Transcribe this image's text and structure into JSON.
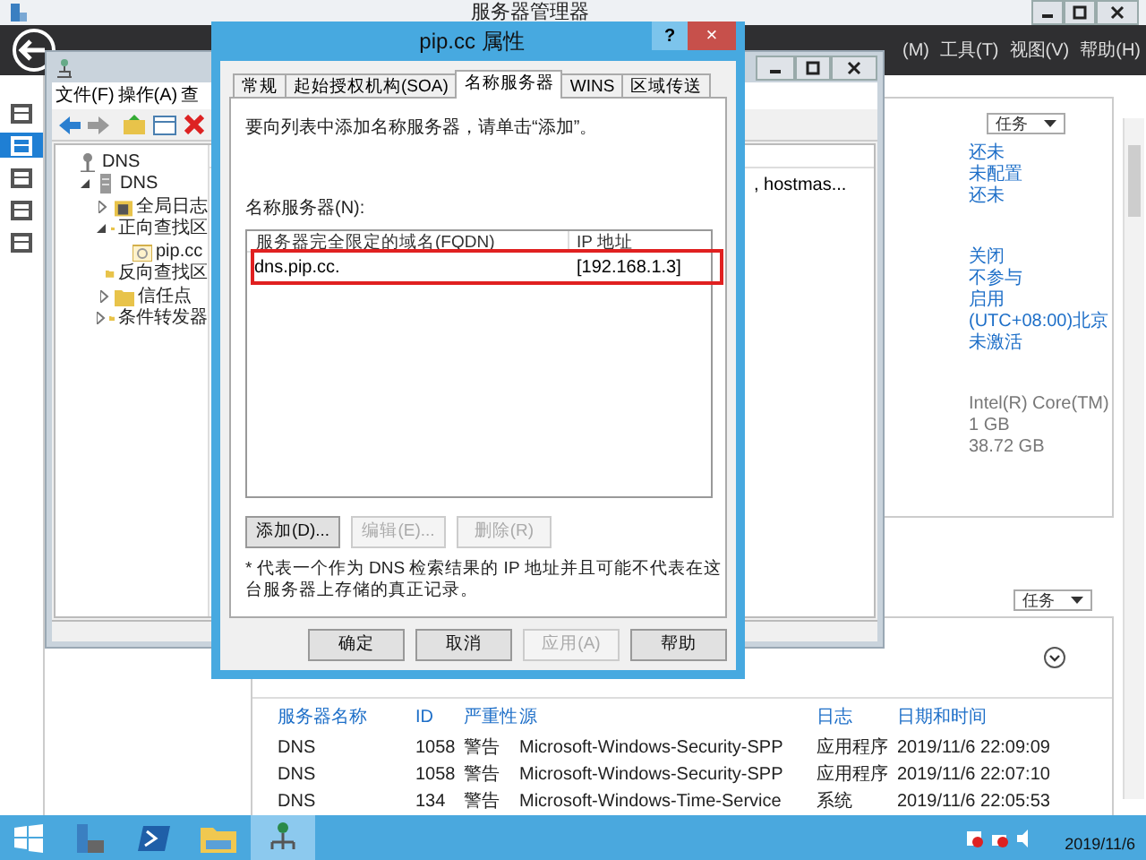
{
  "server_manager": {
    "title": "服务器管理器",
    "menu": [
      "(M)",
      "工具(T)",
      "视图(V)",
      "帮助(H)"
    ],
    "nav": [
      {
        "selected": false
      },
      {
        "selected": true
      },
      {
        "selected": false
      },
      {
        "selected": false
      },
      {
        "selected": false
      }
    ],
    "tasks_button": "任务",
    "properties": [
      {
        "kind": "link",
        "text": "还未"
      },
      {
        "kind": "link",
        "text": "未配置"
      },
      {
        "kind": "link",
        "text": "还未"
      },
      {
        "kind": "gap"
      },
      {
        "kind": "link",
        "text": "关闭"
      },
      {
        "kind": "link",
        "text": "不参与"
      },
      {
        "kind": "link",
        "text": "启用"
      },
      {
        "kind": "link",
        "text": "(UTC+08:00)北京"
      },
      {
        "kind": "link",
        "text": "未激活"
      },
      {
        "kind": "gap"
      },
      {
        "kind": "plain",
        "text": "Intel(R) Core(TM)"
      },
      {
        "kind": "plain",
        "text": "1 GB"
      },
      {
        "kind": "plain",
        "text": "38.72 GB"
      }
    ],
    "events_tasks_button": "任务",
    "events": {
      "columns": [
        "服务器名称",
        "ID",
        "严重性",
        "源",
        "日志",
        "日期和时间"
      ],
      "rows": [
        [
          "DNS",
          "1058",
          "警告",
          "Microsoft-Windows-Security-SPP",
          "应用程序",
          "2019/11/6 22:09:09"
        ],
        [
          "DNS",
          "1058",
          "警告",
          "Microsoft-Windows-Security-SPP",
          "应用程序",
          "2019/11/6 22:07:10"
        ],
        [
          "DNS",
          "134",
          "警告",
          "Microsoft-Windows-Time-Service",
          "系统",
          "2019/11/6 22:05:53"
        ]
      ]
    }
  },
  "dns_manager": {
    "menu": [
      "文件(F)",
      "操作(A)",
      "查"
    ],
    "tree": [
      {
        "label": "DNS",
        "kind": "root",
        "children": [
          {
            "label": "DNS",
            "kind": "server",
            "expanded": true,
            "children": [
              {
                "label": "全局日志",
                "kind": "log",
                "expanded": false
              },
              {
                "label": "正向查找区",
                "kind": "folder",
                "expanded": true,
                "children": [
                  {
                    "label": "pip.cc",
                    "kind": "zone"
                  }
                ]
              },
              {
                "label": "反向查找区",
                "kind": "folder"
              },
              {
                "label": "信任点",
                "kind": "folder",
                "expanded": false
              },
              {
                "label": "条件转发器",
                "kind": "folder",
                "expanded": false
              }
            ]
          }
        ]
      }
    ],
    "detail_text": ", hostmas..."
  },
  "dialog": {
    "title": "pip.cc 属性",
    "help": "?",
    "close": "×",
    "tabs": [
      {
        "label": "常规",
        "selected": false
      },
      {
        "label": "起始授权机构(SOA)",
        "selected": false
      },
      {
        "label": "名称服务器",
        "selected": true
      },
      {
        "label": "WINS",
        "selected": false
      },
      {
        "label": "区域传送",
        "selected": false
      }
    ],
    "instruction": "要向列表中添加名称服务器，请单击“添加”。",
    "list_label": "名称服务器(N):",
    "columns": [
      "服务器完全限定的域名(FQDN)",
      "IP 地址"
    ],
    "rows": [
      {
        "fqdn": "dns.pip.cc.",
        "ip": "[192.168.1.3]",
        "highlighted": true
      }
    ],
    "list_buttons": [
      {
        "label": "添加(D)...",
        "disabled": false
      },
      {
        "label": "编辑(E)...",
        "disabled": true
      },
      {
        "label": "删除(R)",
        "disabled": true
      }
    ],
    "note": "* 代表一个作为 DNS 检索结果的 IP 地址并且可能不代表在这台服务器上存储的真正记录。",
    "buttons": [
      {
        "label": "确定",
        "disabled": false
      },
      {
        "label": "取消",
        "disabled": false
      },
      {
        "label": "应用(A)",
        "disabled": true
      },
      {
        "label": "帮助",
        "disabled": false
      }
    ]
  },
  "taskbar": {
    "apps": [
      {
        "kind": "start",
        "active": false
      },
      {
        "kind": "server",
        "active": false
      },
      {
        "kind": "shell",
        "active": false
      },
      {
        "kind": "folder",
        "active": false
      },
      {
        "kind": "network",
        "active": true
      }
    ],
    "date": "2019/11/6"
  }
}
